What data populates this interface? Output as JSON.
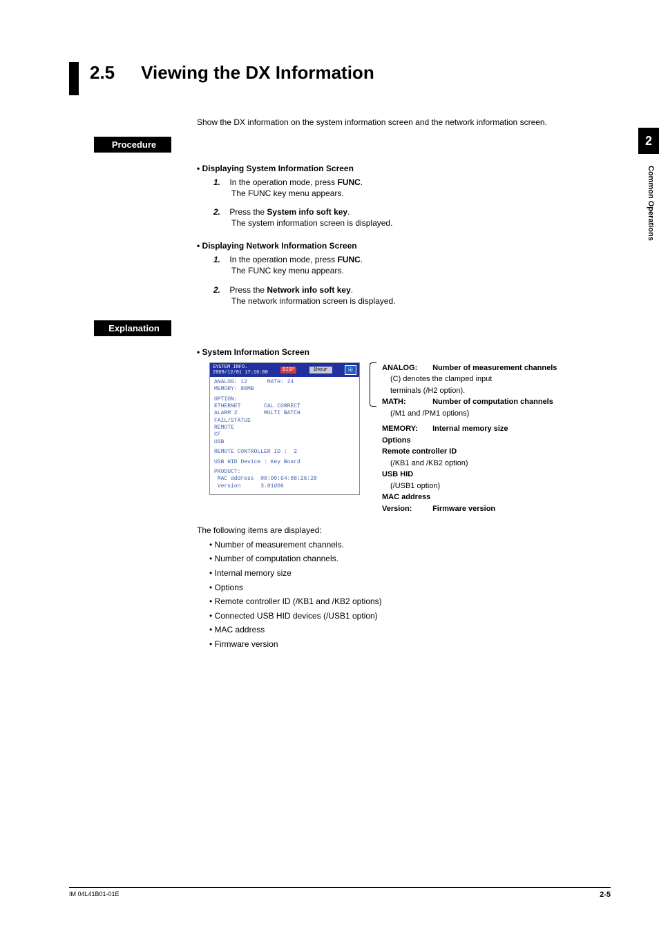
{
  "sidetab": {
    "num": "2",
    "label": "Common Operations"
  },
  "title": {
    "num": "2.5",
    "main": "Viewing the DX Information"
  },
  "intro": "Show the DX information on the system information screen and the network information screen.",
  "procedure_label": "Procedure",
  "explanation_label": "Explanation",
  "sys_heading": "Displaying System Information Screen",
  "net_heading": "Displaying Network Information Screen",
  "steps_sys": {
    "s1a": "In the operation mode, press ",
    "s1b": "FUNC",
    "s1c": ".",
    "s1sub": "The FUNC key menu appears.",
    "s2a": "Press the ",
    "s2b": "System info soft key",
    "s2c": ".",
    "s2sub": "The system information screen is displayed."
  },
  "steps_net": {
    "s1a": "In the operation mode, press ",
    "s1b": "FUNC",
    "s1c": ".",
    "s1sub": "The FUNC key menu appears.",
    "s2a": "Press the ",
    "s2b": "Network info soft key",
    "s2c": ".",
    "s2sub": "The network information screen is displayed."
  },
  "explain_heading": "System Information Screen",
  "device": {
    "header_left1": "SYSTEM INFO.",
    "header_left2": "2008/12/01 17:16:00",
    "tag1": "DISP",
    "tag2": "1hour",
    "tag3": "⦿",
    "l_analog": "ANALOG: 12      MATH: 24",
    "l_memory": "MEMORY: 80MB",
    "l_option": "OPTION:",
    "l_eth": "ETHERNET       CAL CORRECT",
    "l_alarm": "ALARM 2        MULTI BATCH",
    "l_fail": "FAIL/STATUS",
    "l_remote": "REMOTE",
    "l_cf": "CF",
    "l_usb": "USB",
    "l_rcid": "REMOTE CONTROLLER ID :  2",
    "l_usbhid": "USB HID Device : Key Board",
    "l_prod": "PRODUCT:",
    "l_mac": " MAC address  00:00:64:88:26:28",
    "l_ver": " Version      3.01d06"
  },
  "legend": {
    "analog_l": "ANALOG:",
    "analog_v": "Number of measurement channels",
    "analog_s1": "(C) denotes the clamped input",
    "analog_s2": "terminals (/H2 option).",
    "math_l": "MATH:",
    "math_v": "Number of computation channels",
    "math_s": "(/M1 and /PM1 options)",
    "memory_l": "MEMORY:",
    "memory_v": "Internal memory size",
    "options": "Options",
    "rc_l": "Remote controller ID",
    "rc_s": "(/KB1 and /KB2 option)",
    "usbhid_l": "USB HID",
    "usbhid_s": "(/USB1 option)",
    "mac_l": "MAC address",
    "ver_l": "Version:",
    "ver_v": "Firmware version"
  },
  "followup_intro": "The following items are displayed:",
  "followup_items": [
    "Number of measurement channels.",
    "Number of computation channels.",
    "Internal memory size",
    "Options",
    "Remote controller ID (/KB1 and /KB2 options)",
    "Connected USB HID devices (/USB1 option)",
    "MAC address",
    "Firmware version"
  ],
  "footer": {
    "doc": "IM 04L41B01-01E",
    "page": "2-5"
  }
}
